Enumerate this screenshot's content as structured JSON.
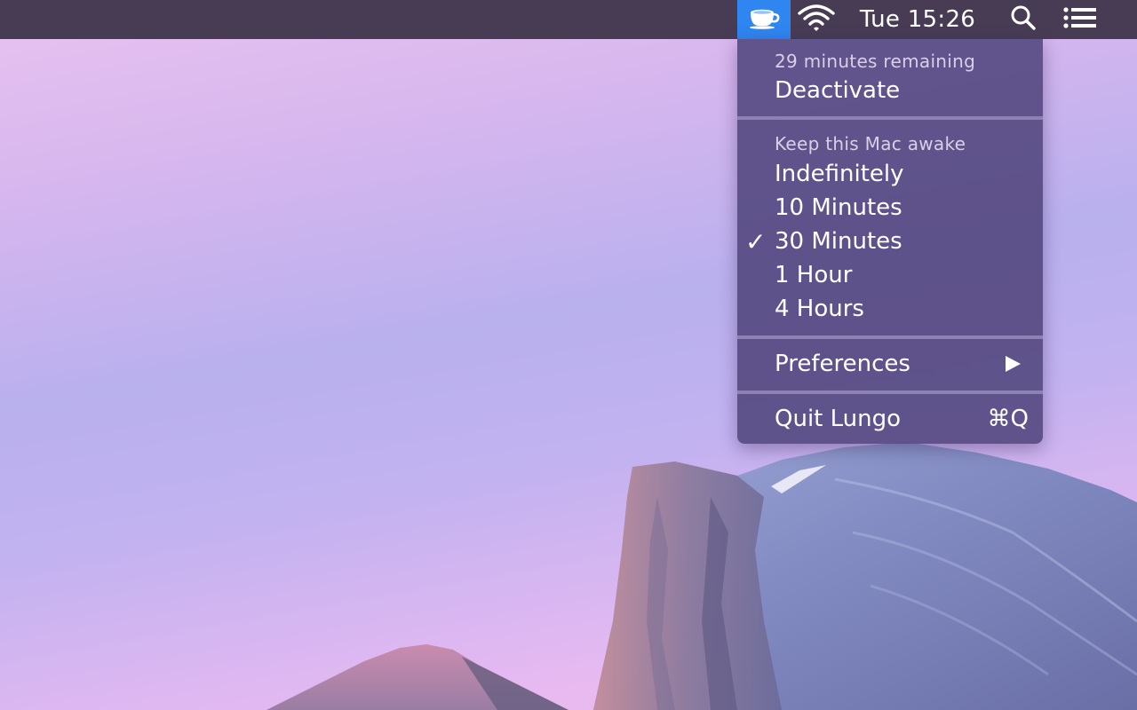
{
  "menubar": {
    "app_icon": "coffee-cup-icon",
    "wifi_icon": "wifi-icon",
    "clock": "Tue 15:26",
    "search_icon": "magnifier-icon",
    "list_icon": "notification-center-icon",
    "active_color": "#2f86f0"
  },
  "menu": {
    "status": "29 minutes remaining",
    "deactivate": "Deactivate",
    "keep_awake_header": "Keep this Mac awake",
    "durations": [
      "Indefinitely",
      "10 Minutes",
      "30 Minutes",
      "1 Hour",
      "4 Hours"
    ],
    "selected_duration": "30 Minutes",
    "checkmark": "✓",
    "preferences": "Preferences",
    "quit": "Quit Lungo",
    "quit_shortcut": "⌘Q"
  }
}
